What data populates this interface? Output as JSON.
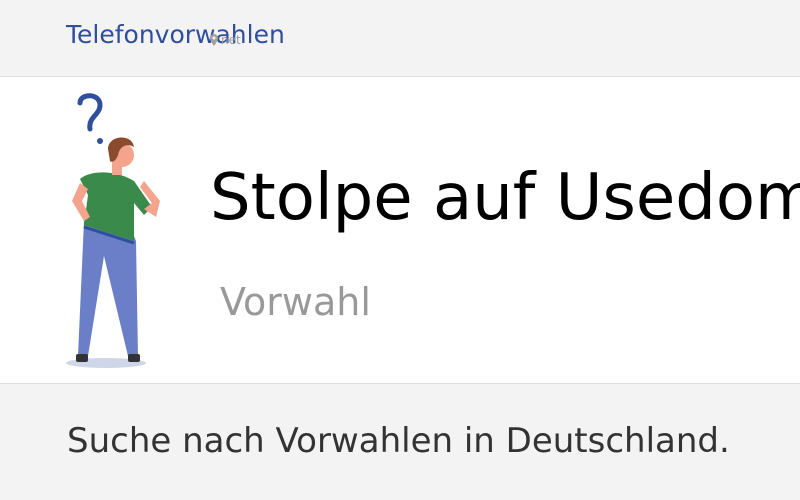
{
  "header": {
    "logo_title": "Telefonvorwahlen",
    "logo_sub": "net"
  },
  "hero": {
    "illustration": "person-thinking-with-question-mark",
    "city": "Stolpe auf Usedom",
    "subtitle": "Vorwahl"
  },
  "main": {
    "search_text": "Suche nach Vorwahlen in Deutschland."
  },
  "colors": {
    "brand": "#2f4f9c",
    "shirt": "#3a8a4b",
    "pants": "#6a7fc7",
    "skin": "#f4a38c",
    "hair": "#8a4b2c"
  }
}
